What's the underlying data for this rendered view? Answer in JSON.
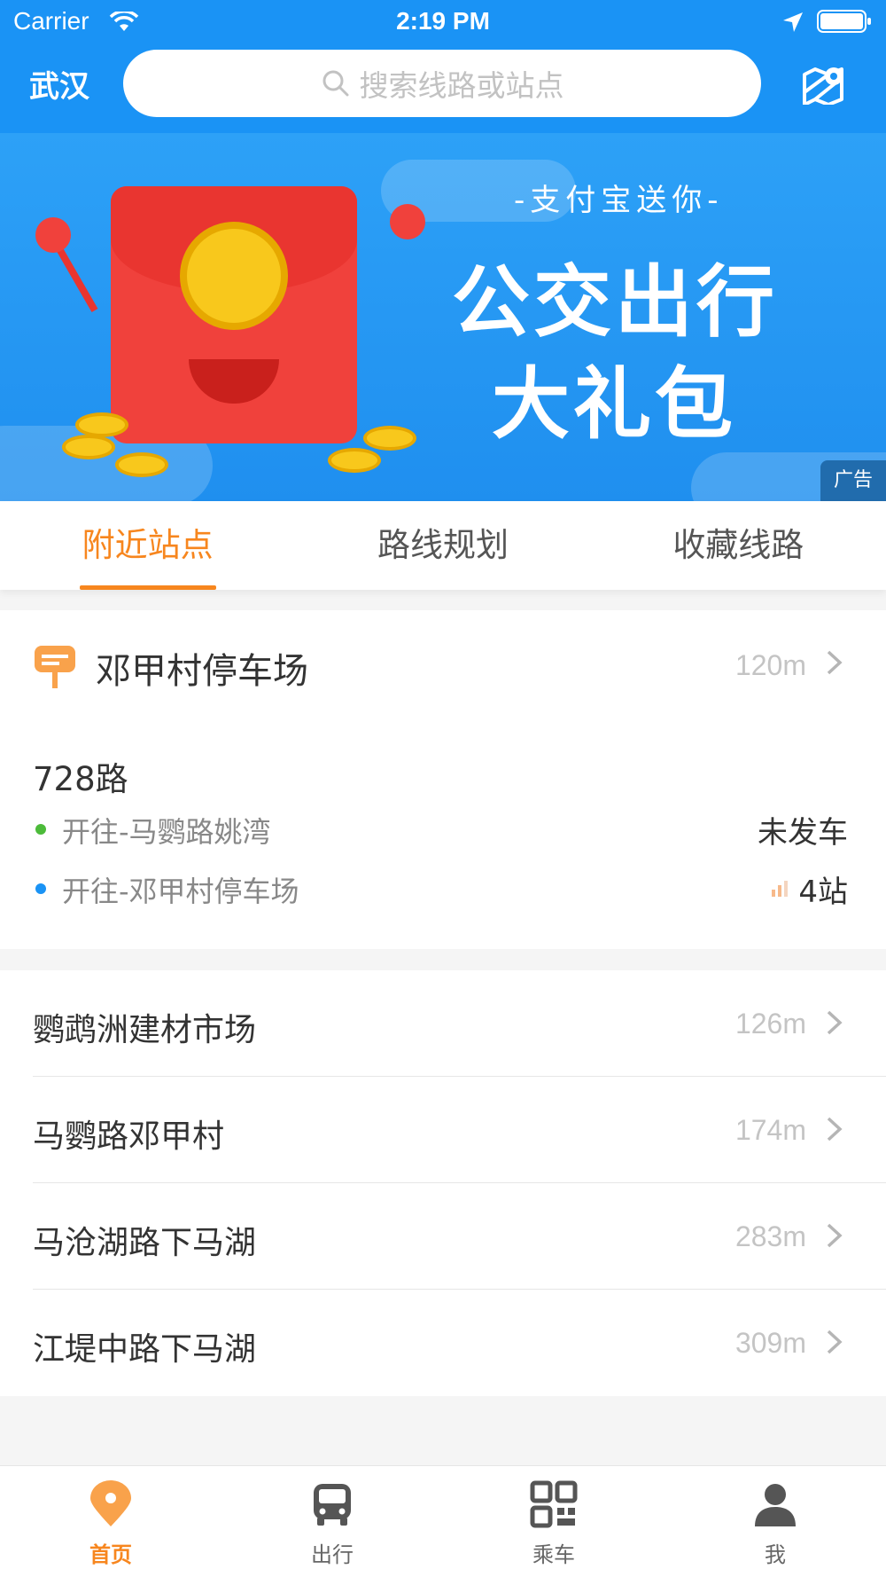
{
  "status_bar": {
    "carrier": "Carrier",
    "time": "2:19 PM"
  },
  "header": {
    "city": "武汉",
    "search_placeholder": "搜索线路或站点"
  },
  "banner": {
    "subtitle": "-支付宝送你-",
    "title_line1": "公交出行",
    "title_line2": "大礼包",
    "ad_label": "广告"
  },
  "tabs": [
    {
      "label": "附近站点",
      "active": true
    },
    {
      "label": "路线规划",
      "active": false
    },
    {
      "label": "收藏线路",
      "active": false
    }
  ],
  "nearby_stop": {
    "name": "邓甲村停车场",
    "distance": "120m",
    "route": "728路",
    "directions": [
      {
        "label": "开往-马鹦路姚湾",
        "status": "未发车",
        "dot_color": "#4cbb3a"
      },
      {
        "label": "开往-邓甲村停车场",
        "status": "4站",
        "dot_color": "#1a93f5"
      }
    ]
  },
  "stops": [
    {
      "name": "鹦鹉洲建材市场",
      "distance": "126m"
    },
    {
      "name": "马鹦路邓甲村",
      "distance": "174m"
    },
    {
      "name": "马沧湖路下马湖",
      "distance": "283m"
    },
    {
      "name": "江堤中路下马湖",
      "distance": "309m"
    }
  ],
  "tabbar": [
    {
      "label": "首页",
      "icon": "home-pin-icon",
      "active": true
    },
    {
      "label": "出行",
      "icon": "bus-icon",
      "active": false
    },
    {
      "label": "乘车",
      "icon": "qr-code-icon",
      "active": false
    },
    {
      "label": "我",
      "icon": "user-icon",
      "active": false
    }
  ],
  "colors": {
    "primary": "#1a93f5",
    "accent": "#f7861e"
  }
}
